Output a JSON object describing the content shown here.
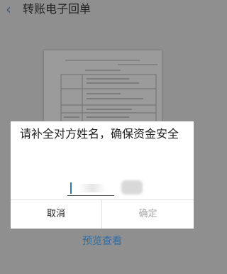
{
  "header": {
    "back_icon": "chevron-left-icon",
    "title": "转账电子回单"
  },
  "receipt": {
    "heading": "转账电子回单"
  },
  "dialog": {
    "prompt": "请补全对方姓名，确保资金安全",
    "name_input_value": "",
    "cancel_label": "取消",
    "confirm_label": "确定"
  },
  "footer": {
    "preview_link": "预览查看"
  },
  "colors": {
    "overlay": "#8f8f8f",
    "accent": "#2e6fa7",
    "disabled": "#a6a6a6"
  }
}
